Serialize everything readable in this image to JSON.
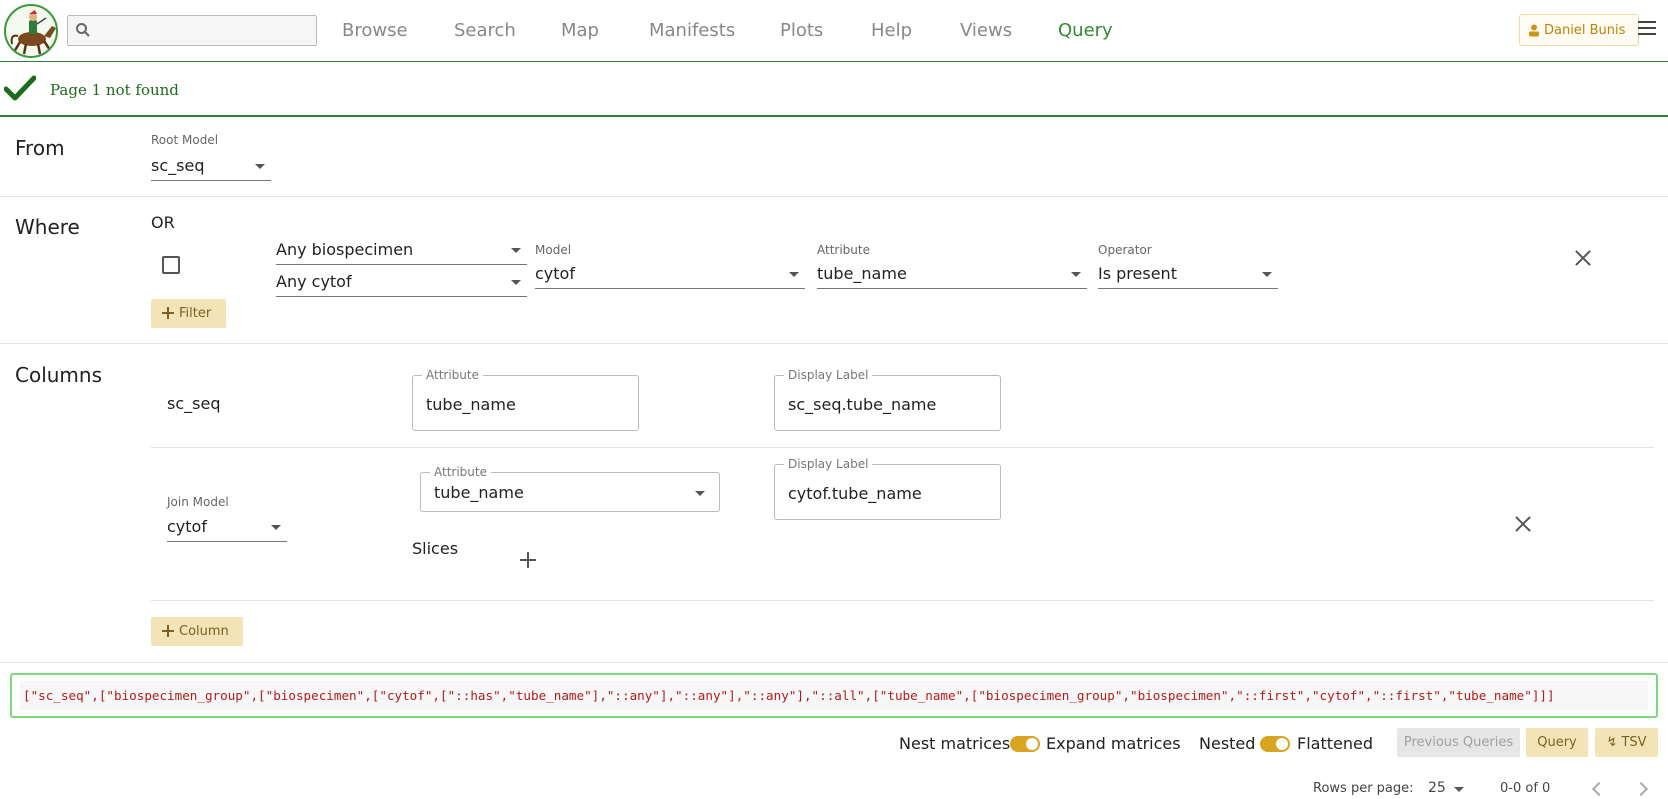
{
  "nav": {
    "search_placeholder": "",
    "links": [
      "Browse",
      "Search",
      "Map",
      "Manifests",
      "Plots",
      "Help",
      "Views",
      "Query"
    ],
    "active_link": "Query",
    "user": "Daniel Bunis"
  },
  "message": {
    "text": "Page 1 not found"
  },
  "from": {
    "title": "From",
    "root_model_label": "Root Model",
    "root_model": "sc_seq"
  },
  "where": {
    "title": "Where",
    "logic": "OR",
    "filter": {
      "scope_1": "Any biospecimen",
      "scope_2": "Any cytof",
      "model_label": "Model",
      "model": "cytof",
      "attribute_label": "Attribute",
      "attribute": "tube_name",
      "operator_label": "Operator",
      "operator": "Is present"
    },
    "add_filter": "Filter"
  },
  "columns": {
    "title": "Columns",
    "root_row": {
      "model": "sc_seq",
      "attribute_label": "Attribute",
      "attribute": "tube_name",
      "display_label_label": "Display Label",
      "display_label": "sc_seq.tube_name"
    },
    "join_row": {
      "join_model_label": "Join Model",
      "join_model": "cytof",
      "attribute_label": "Attribute",
      "attribute": "tube_name",
      "display_label_label": "Display Label",
      "display_label": "cytof.tube_name",
      "slices_label": "Slices"
    },
    "add_column": "Column"
  },
  "query_code": "[\"sc_seq\",[\"biospecimen_group\",[\"biospecimen\",[\"cytof\",[\"::has\",\"tube_name\"],\"::any\"],\"::any\"],\"::any\"],\"::all\",[\"tube_name\",[\"biospecimen_group\",\"biospecimen\",\"::first\",\"cytof\",\"::first\",\"tube_name\"]]]",
  "controls": {
    "nest_left": "Nest matrices",
    "nest_right": "Expand matrices",
    "flat_left": "Nested",
    "flat_right": "Flattened",
    "previous_queries": "Previous Queries",
    "query": "Query",
    "tsv": "↯ TSV"
  },
  "pager": {
    "rows_per_page_label": "Rows per page:",
    "rows_per_page": "25",
    "range": "0-0 of 0"
  },
  "colors": {
    "accent_green": "#2e8b2e",
    "gold": "#d9a520",
    "code_red": "#b31b1b"
  }
}
